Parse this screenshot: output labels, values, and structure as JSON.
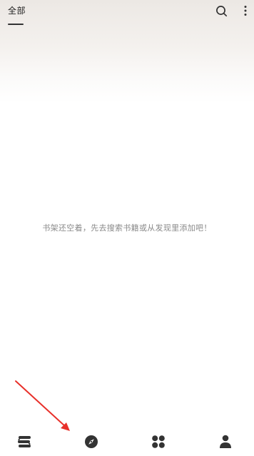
{
  "header": {
    "tab_label": "全部",
    "search_icon": "search-icon",
    "more_icon": "more-vertical-icon"
  },
  "main": {
    "empty_message": "书架还空着，先去搜索书籍或从发现里添加吧！"
  },
  "bottom_nav": {
    "items": [
      {
        "icon": "bookshelf-icon",
        "active": true
      },
      {
        "icon": "compass-icon",
        "active": false
      },
      {
        "icon": "grid-icon",
        "active": false
      },
      {
        "icon": "person-icon",
        "active": false
      }
    ]
  },
  "colors": {
    "icon": "#333333",
    "empty_text": "#8a8a8a",
    "arrow": "#e8302a"
  }
}
